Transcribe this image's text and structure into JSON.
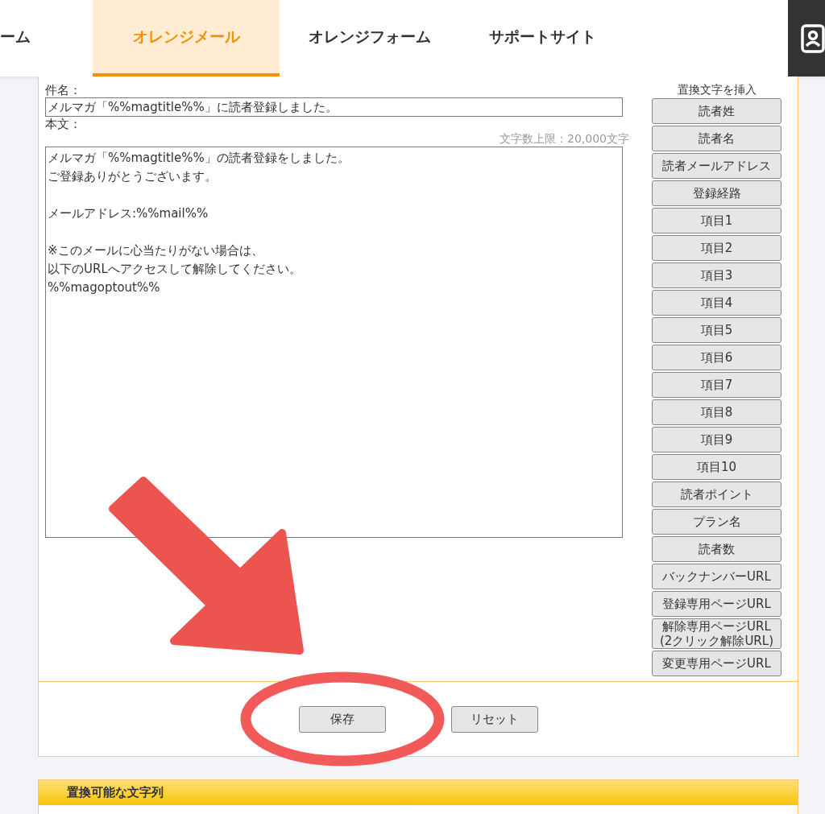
{
  "nav": {
    "tabs": [
      {
        "label": "ーム",
        "selected": false
      },
      {
        "label": "オレンジメール",
        "selected": true
      },
      {
        "label": "オレンジフォーム",
        "selected": false
      },
      {
        "label": "サポートサイト",
        "selected": false
      }
    ]
  },
  "form": {
    "subject_label": "件名：",
    "subject_value": "メルマガ「%%magtitle%%」に読者登録しました。",
    "body_label": "本文：",
    "char_limit": "文字数上限：20,000文字",
    "body_paragraphs": [
      [
        "メルマガ「%%magtitle%%」の読者登録をしました。",
        "ご登録ありがとうございます。"
      ],
      [
        "メールアドレス:%%mail%%"
      ],
      [
        "※このメールに心当たりがない場合は、",
        "以下のURLへアクセスして解除してください。",
        "%%magoptout%%"
      ]
    ]
  },
  "insert": {
    "title": "置換文字を挿入",
    "buttons": [
      "読者姓",
      "読者名",
      "読者メールアドレス",
      "登録経路",
      "項目1",
      "項目2",
      "項目3",
      "項目4",
      "項目5",
      "項目6",
      "項目7",
      "項目8",
      "項目9",
      "項目10",
      "読者ポイント",
      "プラン名",
      "読者数",
      "バックナンバーURL",
      "登録専用ページURL",
      "解除専用ページURL\n(2クリック解除URL)",
      "変更専用ページURL"
    ]
  },
  "actions": [
    "保存",
    "リセット"
  ],
  "section": {
    "title": "置換可能な文字列"
  }
}
